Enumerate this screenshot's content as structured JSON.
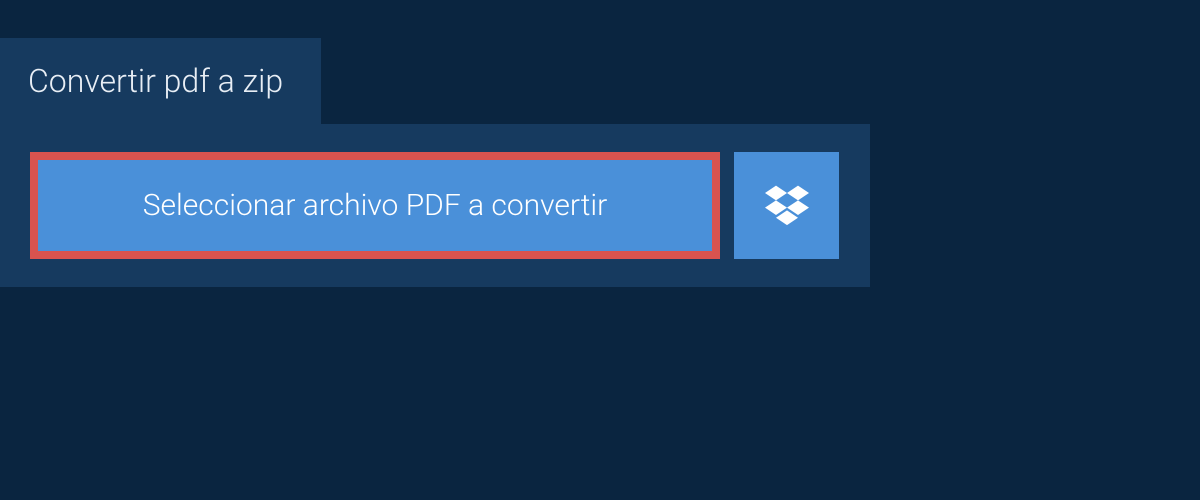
{
  "tab": {
    "title": "Convertir pdf a zip"
  },
  "upload": {
    "select_file_label": "Seleccionar archivo PDF a convertir"
  }
}
